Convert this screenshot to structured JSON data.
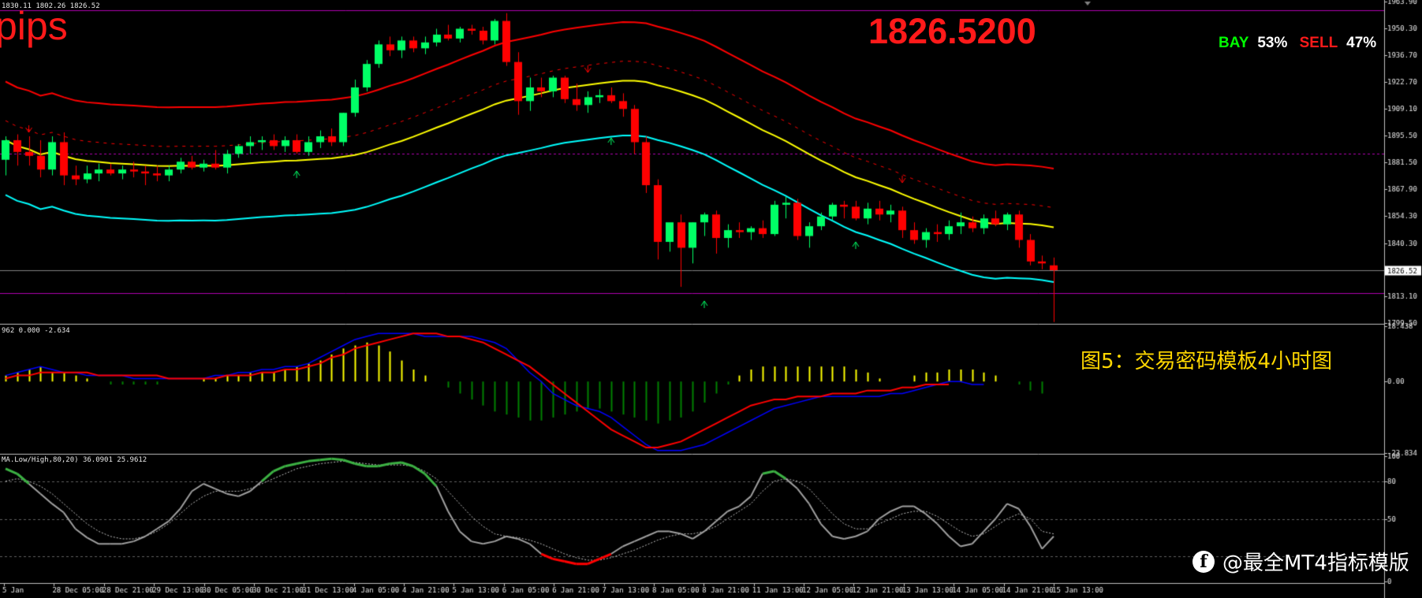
{
  "header": {
    "ohlc_info": "1830.11 1802.26 1826.52",
    "macd_info": "962 0.000 -2.634",
    "osc_info": "MA.Low/High,80,20) 36.0901 25.9612"
  },
  "overlay": {
    "pips_label": "pips",
    "current_price": "1826.5200",
    "buy_label": "BAY",
    "buy_pct": "53%",
    "sell_label": "SELL",
    "sell_pct": "47%",
    "caption": "图5：交易密码模板4小时图",
    "watermark": "@最全MT4指标模版",
    "watermark_icon": "toutiao-logo-icon"
  },
  "colors": {
    "bull_candle": "#00ff66",
    "bear_candle": "#ff0000",
    "upper_band": "#ff0000",
    "middle_ma": "#ffff00",
    "lower_band": "#00ffff",
    "macd_main": "#0000ff",
    "macd_signal": "#ff0000",
    "hist_positive": "#ffff00",
    "hist_negative": "#008000",
    "level_lines": "#b000b0"
  },
  "chart_data": [
    {
      "type": "candlestick",
      "y_ticks": [
        "1963.90",
        "1950.30",
        "1936.70",
        "1922.70",
        "1909.10",
        "1895.50",
        "1881.50",
        "1867.90",
        "1854.30",
        "1840.30",
        "1826.52",
        "1813.10",
        "1799.50"
      ],
      "ylim": [
        1799.5,
        1963.9
      ],
      "current_price": 1826.52,
      "level_lines": [
        1959.5,
        1886.0,
        1815.0
      ],
      "x_tick_labels": [
        "5 Jan",
        "28 Dec 05:00",
        "28 Dec 21:00",
        "29 Dec 13:00",
        "30 Dec 05:00",
        "30 Dec 21:00",
        "31 Dec 13:00",
        "4 Jan 05:00",
        "4 Jan 21:00",
        "5 Jan 13:00",
        "6 Jan 05:00",
        "6 Jan 21:00",
        "7 Jan 13:00",
        "8 Jan 05:00",
        "8 Jan 21:00",
        "11 Jan 13:00",
        "12 Jan 05:00",
        "12 Jan 21:00",
        "13 Jan 13:00",
        "14 Jan 05:00",
        "14 Jan 21:00",
        "15 Jan 13:00"
      ],
      "candles": [
        [
          1883,
          1895,
          1875,
          1893
        ],
        [
          1893,
          1896,
          1880,
          1887
        ],
        [
          1887,
          1895,
          1880,
          1885
        ],
        [
          1885,
          1893,
          1874,
          1878
        ],
        [
          1878,
          1895,
          1875,
          1892
        ],
        [
          1892,
          1897,
          1870,
          1875
        ],
        [
          1875,
          1880,
          1870,
          1873
        ],
        [
          1873,
          1880,
          1871,
          1876
        ],
        [
          1876,
          1881,
          1872,
          1878
        ],
        [
          1878,
          1881,
          1875,
          1876
        ],
        [
          1876,
          1880,
          1873,
          1878
        ],
        [
          1878,
          1882,
          1874,
          1877
        ],
        [
          1877,
          1880,
          1870,
          1876
        ],
        [
          1876,
          1880,
          1872,
          1875
        ],
        [
          1875,
          1880,
          1872,
          1878
        ],
        [
          1878,
          1884,
          1876,
          1882
        ],
        [
          1882,
          1885,
          1878,
          1879
        ],
        [
          1879,
          1883,
          1877,
          1881
        ],
        [
          1881,
          1888,
          1878,
          1879
        ],
        [
          1879,
          1888,
          1876,
          1886
        ],
        [
          1886,
          1891,
          1884,
          1890
        ],
        [
          1890,
          1895,
          1886,
          1892
        ],
        [
          1892,
          1895,
          1888,
          1893
        ],
        [
          1893,
          1896,
          1888,
          1890
        ],
        [
          1890,
          1895,
          1887,
          1893
        ],
        [
          1893,
          1896,
          1886,
          1887
        ],
        [
          1887,
          1895,
          1885,
          1892
        ],
        [
          1892,
          1898,
          1889,
          1895
        ],
        [
          1895,
          1899,
          1890,
          1892
        ],
        [
          1892,
          1907,
          1890,
          1907
        ],
        [
          1907,
          1924,
          1905,
          1920
        ],
        [
          1920,
          1934,
          1918,
          1932
        ],
        [
          1932,
          1944,
          1930,
          1942
        ],
        [
          1942,
          1946,
          1936,
          1939
        ],
        [
          1939,
          1946,
          1935,
          1944
        ],
        [
          1944,
          1946,
          1938,
          1940
        ],
        [
          1940,
          1946,
          1937,
          1943
        ],
        [
          1943,
          1950,
          1941,
          1947
        ],
        [
          1947,
          1952,
          1944,
          1945
        ],
        [
          1945,
          1951,
          1943,
          1950
        ],
        [
          1950,
          1952,
          1947,
          1949
        ],
        [
          1949,
          1951,
          1942,
          1944
        ],
        [
          1944,
          1955,
          1942,
          1954
        ],
        [
          1954,
          1958,
          1931,
          1933
        ],
        [
          1933,
          1938,
          1906,
          1913
        ],
        [
          1913,
          1925,
          1908,
          1920
        ],
        [
          1920,
          1925,
          1915,
          1918
        ],
        [
          1918,
          1926,
          1915,
          1925
        ],
        [
          1925,
          1926,
          1912,
          1914
        ],
        [
          1914,
          1922,
          1908,
          1911
        ],
        [
          1911,
          1918,
          1907,
          1915
        ],
        [
          1915,
          1919,
          1912,
          1916
        ],
        [
          1916,
          1920,
          1912,
          1913
        ],
        [
          1913,
          1917,
          1905,
          1909
        ],
        [
          1909,
          1911,
          1886,
          1892
        ],
        [
          1892,
          1895,
          1866,
          1870
        ],
        [
          1870,
          1873,
          1832,
          1841
        ],
        [
          1841,
          1850,
          1836,
          1851
        ],
        [
          1851,
          1855,
          1818,
          1838
        ],
        [
          1838,
          1851,
          1830,
          1851
        ],
        [
          1851,
          1856,
          1844,
          1855
        ],
        [
          1855,
          1857,
          1835,
          1843
        ],
        [
          1843,
          1850,
          1838,
          1847
        ],
        [
          1847,
          1851,
          1843,
          1846
        ],
        [
          1846,
          1849,
          1842,
          1848
        ],
        [
          1848,
          1852,
          1843,
          1845
        ],
        [
          1845,
          1862,
          1844,
          1860
        ],
        [
          1860,
          1864,
          1853,
          1861
        ],
        [
          1861,
          1863,
          1842,
          1844
        ],
        [
          1844,
          1851,
          1838,
          1849
        ],
        [
          1849,
          1856,
          1847,
          1854
        ],
        [
          1854,
          1861,
          1852,
          1860
        ],
        [
          1860,
          1862,
          1853,
          1859
        ],
        [
          1859,
          1862,
          1852,
          1853
        ],
        [
          1853,
          1861,
          1850,
          1858
        ],
        [
          1858,
          1862,
          1852,
          1855
        ],
        [
          1855,
          1860,
          1851,
          1857
        ],
        [
          1857,
          1859,
          1843,
          1847
        ],
        [
          1847,
          1851,
          1840,
          1842
        ],
        [
          1842,
          1848,
          1838,
          1846
        ],
        [
          1846,
          1850,
          1841,
          1845
        ],
        [
          1845,
          1852,
          1842,
          1849
        ],
        [
          1849,
          1856,
          1845,
          1851
        ],
        [
          1851,
          1854,
          1846,
          1848
        ],
        [
          1848,
          1855,
          1845,
          1853
        ],
        [
          1853,
          1857,
          1849,
          1850
        ],
        [
          1850,
          1856,
          1847,
          1855
        ],
        [
          1855,
          1857,
          1838,
          1842
        ],
        [
          1842,
          1845,
          1829,
          1831
        ],
        [
          1831,
          1834,
          1827,
          1830
        ],
        [
          1829,
          1833,
          1800,
          1826.52
        ]
      ]
    },
    {
      "type": "macd",
      "y_ticks": [
        "18.438",
        "0.00",
        "-23.834"
      ],
      "ylim": [
        -23.834,
        18.438
      ],
      "histogram": [
        2,
        3,
        4,
        5,
        3,
        3,
        2,
        1,
        0,
        -1,
        -1,
        -1,
        -1,
        -1,
        0,
        0,
        0,
        1,
        1,
        2,
        2,
        3,
        3,
        3,
        4,
        5,
        6,
        7,
        9,
        11,
        12,
        13,
        12,
        10,
        7,
        4,
        2,
        0,
        -2,
        -4,
        -6,
        -8,
        -10,
        -11,
        -12,
        -13,
        -13,
        -12,
        -11,
        -10,
        -9,
        -9,
        -10,
        -11,
        -12,
        -13,
        -14,
        -13,
        -12,
        -10,
        -7,
        -4,
        -1,
        2,
        4,
        5,
        5,
        5,
        5,
        5,
        5,
        5,
        5,
        4,
        3,
        1,
        0,
        0,
        2,
        3,
        3,
        4,
        4,
        4,
        3,
        2,
        0,
        -1,
        -3,
        -4
      ],
      "main": [
        2,
        3,
        4,
        5,
        4,
        3,
        3,
        2,
        2,
        2,
        2,
        1,
        1,
        1,
        1,
        1,
        1,
        1,
        2,
        2,
        3,
        3,
        4,
        4,
        5,
        5,
        6,
        8,
        10,
        12,
        14,
        15,
        16,
        16,
        16,
        16,
        15,
        15,
        15,
        15,
        15,
        14,
        13,
        11,
        7,
        3,
        0,
        -4,
        -6,
        -8,
        -9,
        -10,
        -12,
        -15,
        -18,
        -21,
        -23,
        -23,
        -23,
        -22,
        -21,
        -19,
        -17,
        -15,
        -13,
        -11,
        -9,
        -8,
        -7,
        -6,
        -5,
        -5,
        -5,
        -5,
        -5,
        -5,
        -4,
        -4,
        -3,
        -2,
        -1,
        0,
        0,
        -1,
        -1
      ],
      "signal": [
        1,
        2,
        2,
        3,
        3,
        3,
        3,
        3,
        2,
        2,
        2,
        2,
        2,
        2,
        1,
        1,
        1,
        1,
        1,
        2,
        2,
        2,
        3,
        3,
        4,
        4,
        5,
        6,
        8,
        9,
        11,
        12,
        13,
        14,
        15,
        16,
        16,
        16,
        15,
        15,
        14,
        13,
        11,
        9,
        7,
        5,
        2,
        -1,
        -4,
        -7,
        -10,
        -13,
        -16,
        -18,
        -20,
        -22,
        -22,
        -21,
        -20,
        -18,
        -16,
        -14,
        -12,
        -10,
        -8,
        -7,
        -6,
        -6,
        -5,
        -5,
        -5,
        -4,
        -4,
        -4,
        -3,
        -3,
        -3,
        -2,
        -2,
        -1,
        -1,
        -1
      ]
    },
    {
      "type": "line",
      "y_ticks": [
        "100",
        "80",
        "50",
        "0"
      ],
      "ylim": [
        0,
        100
      ],
      "levels": [
        80,
        50,
        20
      ],
      "main": [
        90,
        86,
        78,
        70,
        62,
        55,
        42,
        35,
        30,
        30,
        30,
        32,
        36,
        42,
        48,
        58,
        72,
        78,
        74,
        70,
        68,
        72,
        80,
        88,
        92,
        94,
        96,
        97,
        98,
        97,
        94,
        92,
        92,
        94,
        95,
        92,
        86,
        76,
        56,
        40,
        32,
        30,
        32,
        36,
        34,
        30,
        22,
        18,
        16,
        14,
        14,
        18,
        22,
        28,
        32,
        36,
        40,
        40,
        38,
        34,
        40,
        48,
        56,
        60,
        68,
        86,
        88,
        82,
        74,
        62,
        46,
        36,
        34,
        36,
        40,
        50,
        56,
        60,
        60,
        54,
        46,
        36,
        28,
        30,
        40,
        50,
        62,
        58,
        44,
        26,
        36
      ],
      "signal": [
        80,
        82,
        80,
        76,
        70,
        62,
        54,
        46,
        40,
        36,
        34,
        34,
        36,
        40,
        46,
        54,
        62,
        68,
        72,
        72,
        72,
        74,
        78,
        82,
        86,
        90,
        92,
        94,
        95,
        96,
        95,
        94,
        93,
        93,
        93,
        92,
        88,
        82,
        72,
        62,
        52,
        44,
        38,
        36,
        35,
        33,
        30,
        26,
        22,
        19,
        17,
        17,
        19,
        22,
        25,
        29,
        33,
        36,
        38,
        38,
        40,
        44,
        50,
        56,
        62,
        72,
        80,
        82,
        80,
        74,
        64,
        54,
        46,
        42,
        42,
        46,
        50,
        54,
        56,
        56,
        52,
        46,
        40,
        36,
        38,
        44,
        50,
        54,
        50,
        40,
        38
      ]
    }
  ]
}
